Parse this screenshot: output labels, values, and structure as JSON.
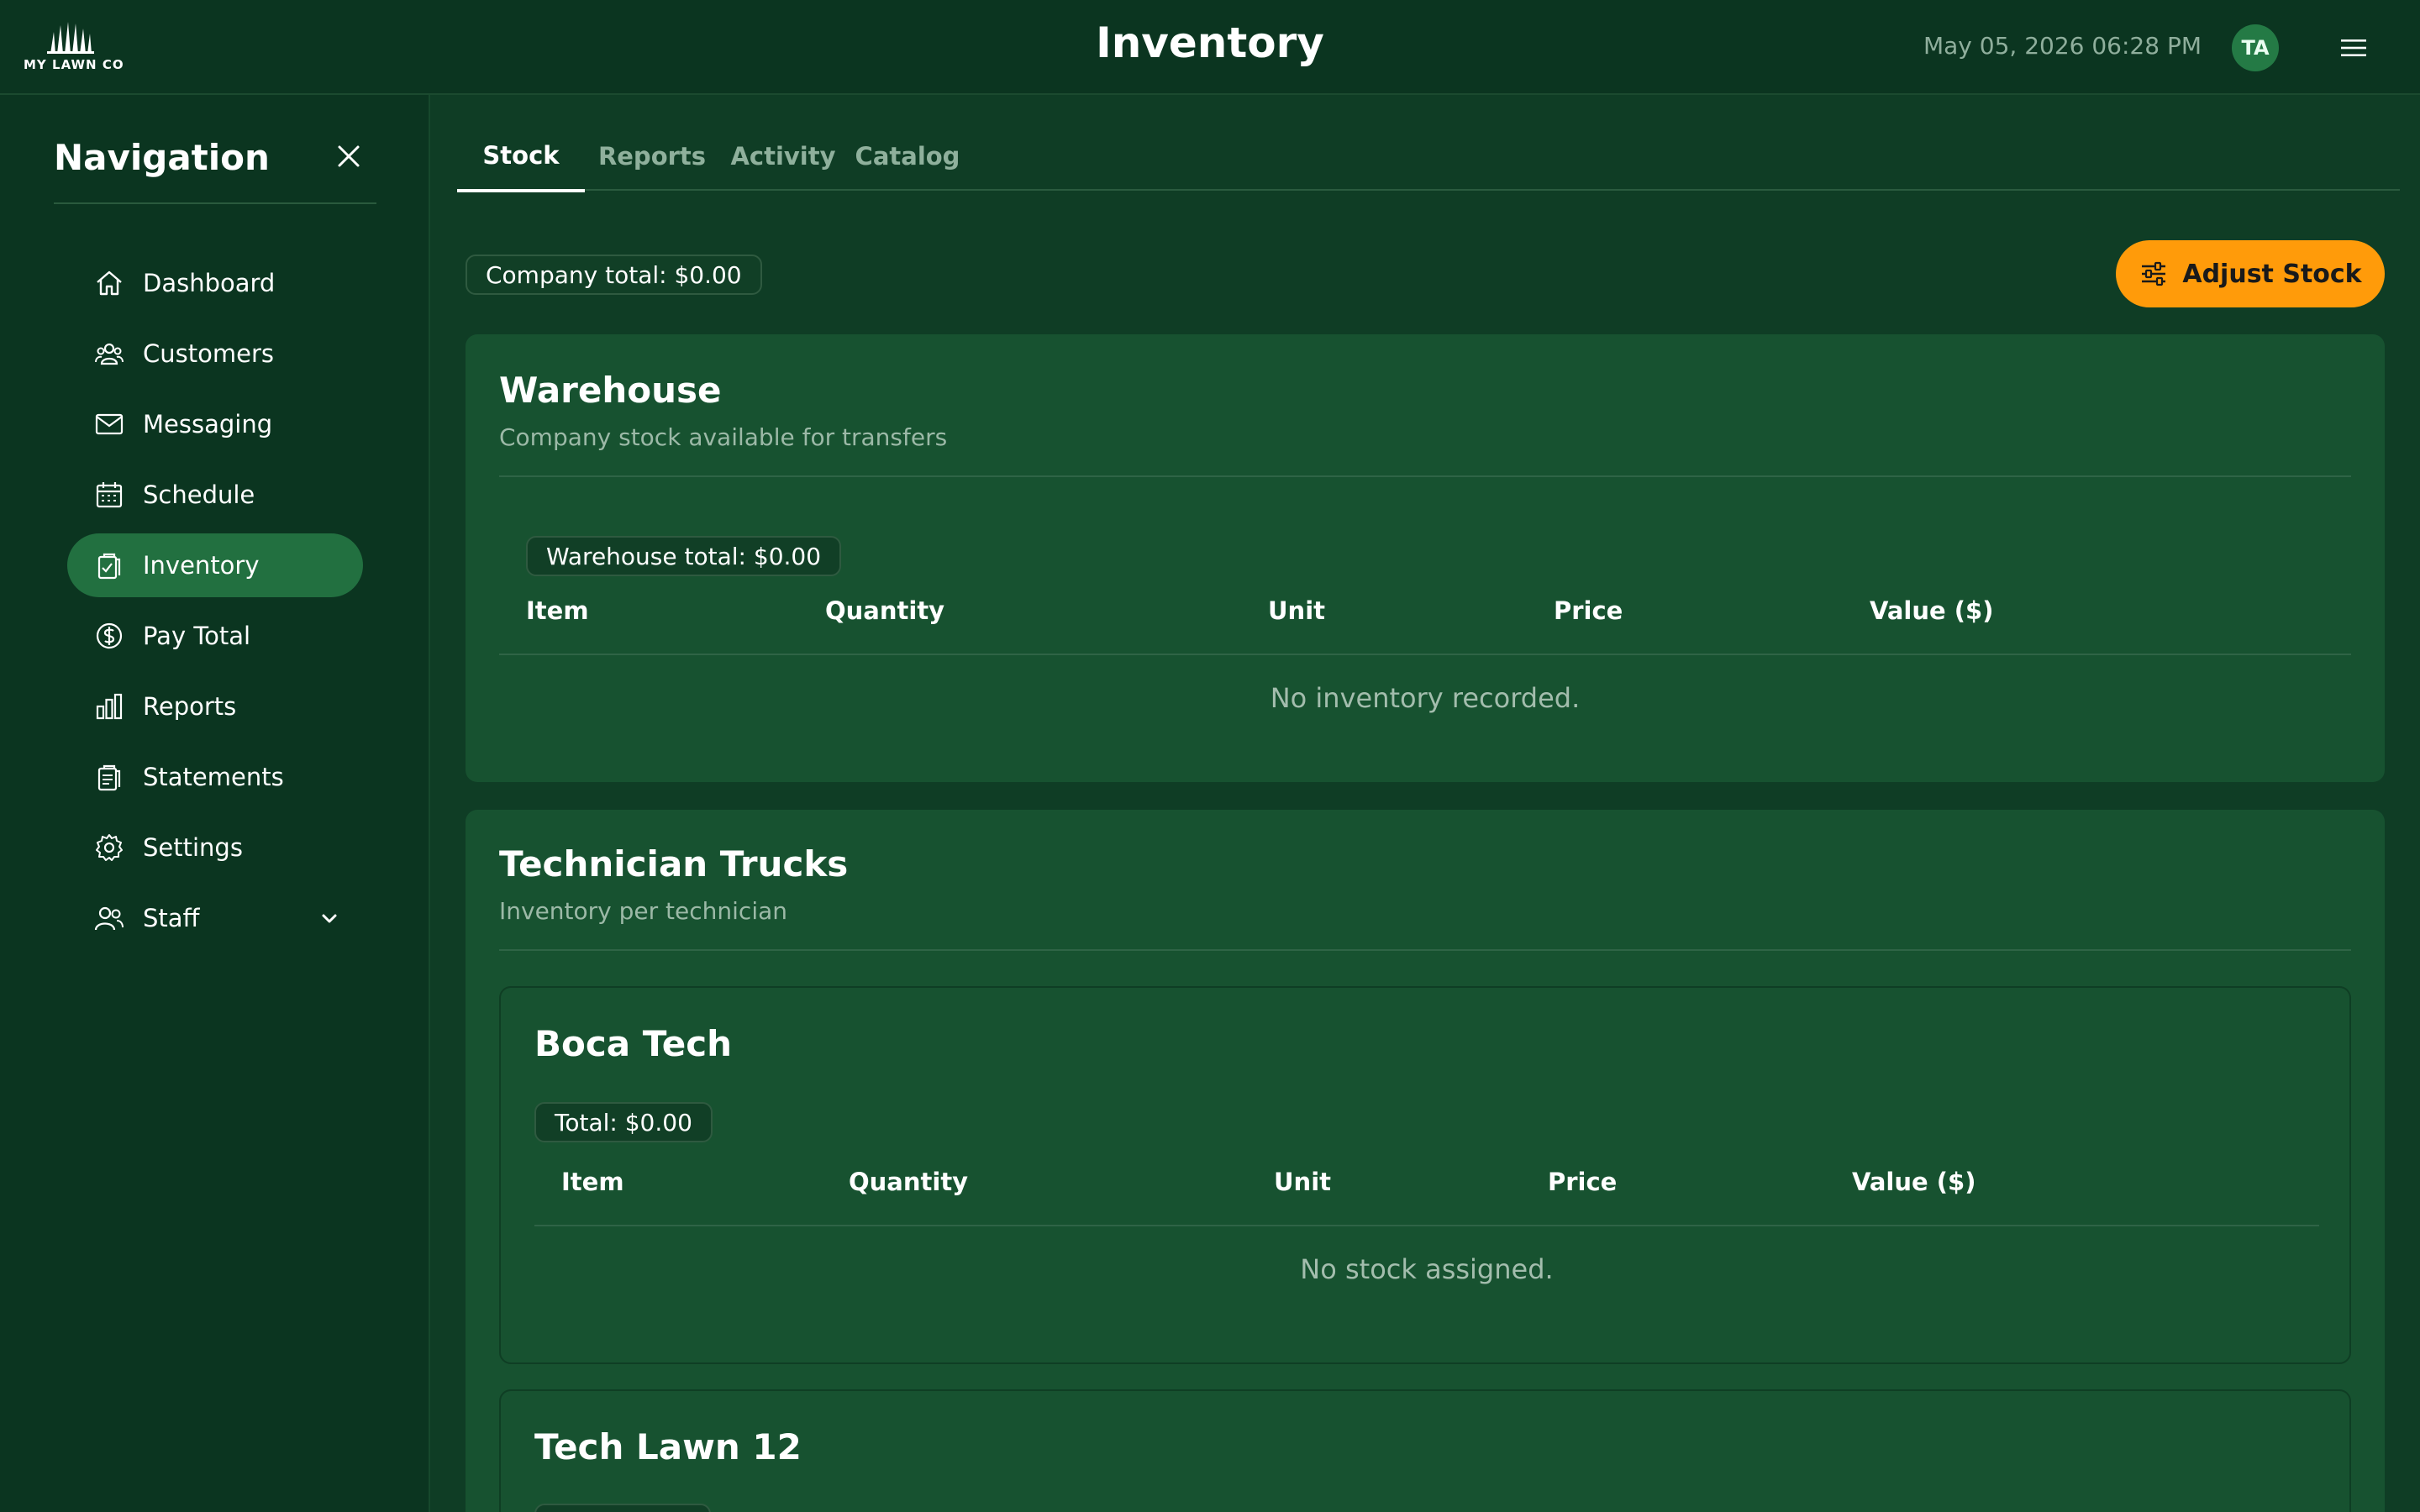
{
  "header": {
    "logo_text": "MY LAWN CO",
    "title": "Inventory",
    "datetime": "May 05, 2026 06:28 PM",
    "avatar_initials": "TA"
  },
  "sidebar": {
    "title": "Navigation",
    "items": [
      {
        "label": "Dashboard",
        "icon": "home-icon"
      },
      {
        "label": "Customers",
        "icon": "customers-icon"
      },
      {
        "label": "Messaging",
        "icon": "mail-icon"
      },
      {
        "label": "Schedule",
        "icon": "calendar-icon"
      },
      {
        "label": "Inventory",
        "icon": "clipboard-check-icon",
        "active": true
      },
      {
        "label": "Pay Total",
        "icon": "dollar-icon"
      },
      {
        "label": "Reports",
        "icon": "bar-chart-icon"
      },
      {
        "label": "Statements",
        "icon": "statements-icon"
      },
      {
        "label": "Settings",
        "icon": "gear-icon"
      },
      {
        "label": "Staff",
        "icon": "staff-icon",
        "expandable": true
      }
    ]
  },
  "tabs": [
    {
      "label": "Stock",
      "active": true
    },
    {
      "label": "Reports"
    },
    {
      "label": "Activity"
    },
    {
      "label": "Catalog"
    }
  ],
  "company_total": "Company total: $0.00",
  "adjust_button": "Adjust Stock",
  "warehouse": {
    "title": "Warehouse",
    "subtitle": "Company stock available for transfers",
    "total": "Warehouse total: $0.00",
    "columns": [
      "Item",
      "Quantity",
      "Unit",
      "Price",
      "Value ($)"
    ],
    "empty": "No inventory recorded."
  },
  "trucks": {
    "title": "Technician Trucks",
    "subtitle": "Inventory per technician",
    "technicians": [
      {
        "name": "Boca Tech",
        "total": "Total: $0.00",
        "columns": [
          "Item",
          "Quantity",
          "Unit",
          "Price",
          "Value ($)"
        ],
        "empty": "No stock assigned."
      },
      {
        "name": "Tech Lawn 12"
      }
    ]
  },
  "colors": {
    "background": "#0f3d25",
    "card": "#175230",
    "active_nav": "#227040",
    "accent_button": "#ff9b0a"
  }
}
